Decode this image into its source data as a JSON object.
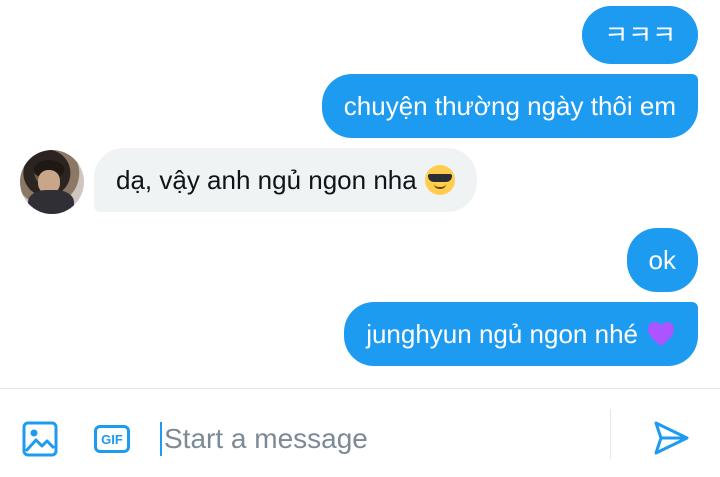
{
  "messages": [
    {
      "id": "m1",
      "direction": "outgoing",
      "text": "ㅋㅋㅋ"
    },
    {
      "id": "m2",
      "direction": "outgoing",
      "text": "chuyện thường ngày thôi em"
    },
    {
      "id": "m3",
      "direction": "incoming",
      "text": "dạ, vậy anh ngủ ngon nha",
      "emoji": "smiling-face-with-sunglasses"
    },
    {
      "id": "m4",
      "direction": "outgoing",
      "text": "ok"
    },
    {
      "id": "m5",
      "direction": "outgoing",
      "text": "junghyun ngủ ngon nhé",
      "emoji": "purple-heart"
    }
  ],
  "composer": {
    "placeholder": "Start a message",
    "value": "",
    "gif_label": "GIF",
    "media_icon": "image-icon",
    "send_icon": "send-icon"
  },
  "colors": {
    "accent": "#1d9bf0",
    "incoming_bubble": "#eff3f4",
    "text": "#0f1419",
    "placeholder": "#7c8a96",
    "heart": "#aa55ff"
  }
}
